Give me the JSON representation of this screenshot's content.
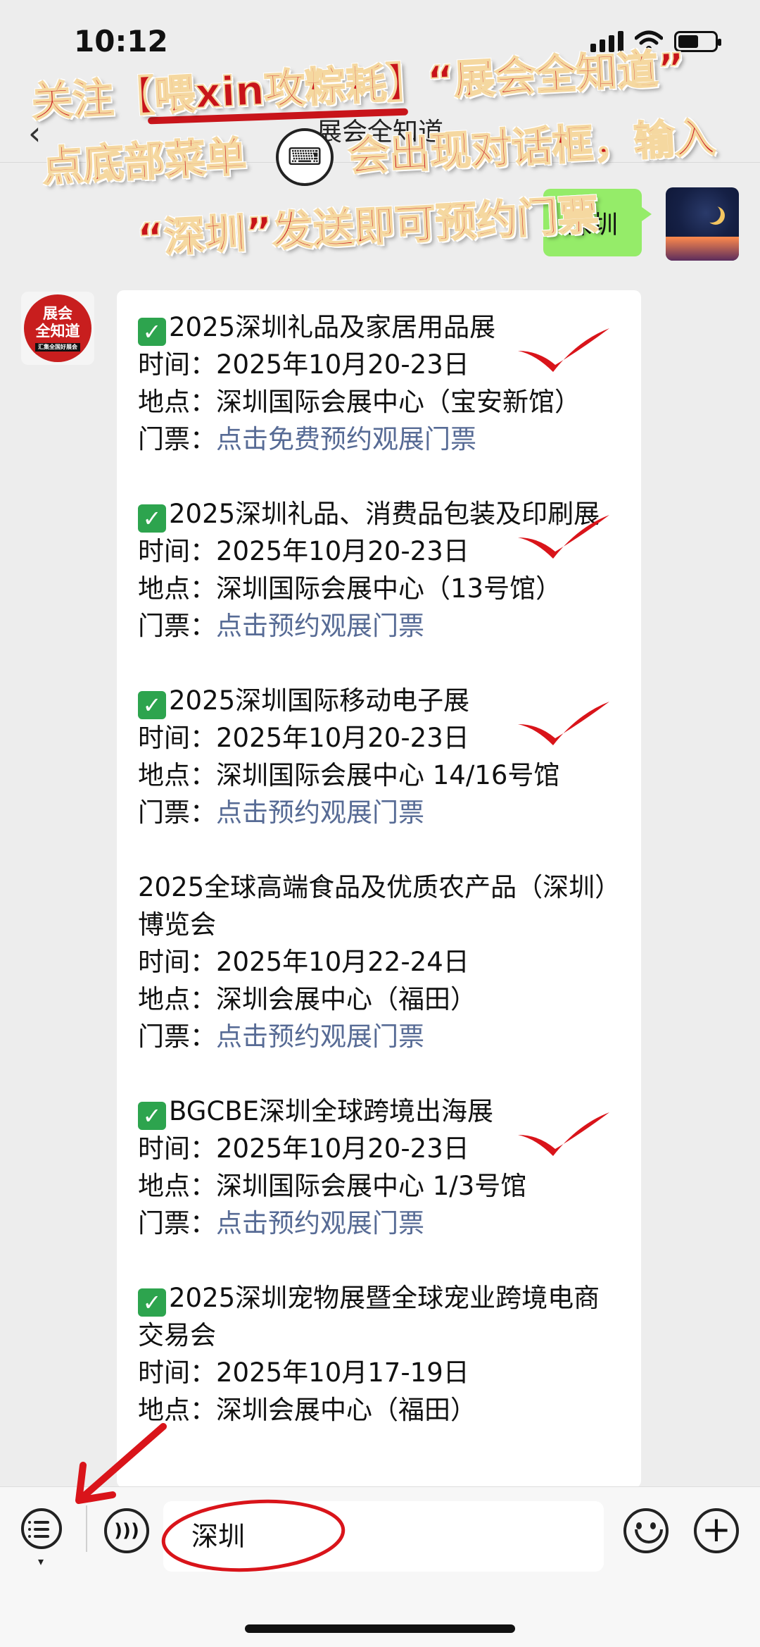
{
  "status_bar": {
    "time": "10:12"
  },
  "nav": {
    "back_glyph": "‹",
    "title": "展会全知道"
  },
  "overlay": {
    "line1": "关注【喂xin攻粽耗】“展会全知道”",
    "line2_left": "点底部菜单",
    "line2_right": "会出现对话框，输入",
    "line3": "“深圳”发送即可预约门票",
    "keyboard_icon": "keyboard-icon"
  },
  "chat": {
    "sent_message": "深圳",
    "bot_avatar": {
      "line1": "展会",
      "line2": "全知道",
      "tagline": "汇集全国好展会"
    },
    "expos": [
      {
        "checked": true,
        "title": "2025深圳礼品及家居用品展",
        "time": "时间：2025年10月20-23日",
        "place": "地点：深圳国际会展中心（宝安新馆）",
        "ticket_label": "门票：",
        "ticket_link": "点击免费预约观展门票",
        "marked": true
      },
      {
        "checked": true,
        "title": "2025深圳礼品、消费品包装及印刷展",
        "time": "时间：2025年10月20-23日",
        "place": "地点：深圳国际会展中心（13号馆）",
        "ticket_label": "门票：",
        "ticket_link": "点击预约观展门票",
        "marked": true
      },
      {
        "checked": true,
        "title": "2025深圳国际移动电子展",
        "time": "时间：2025年10月20-23日",
        "place": "地点：深圳国际会展中心 14/16号馆",
        "ticket_label": "门票：",
        "ticket_link": "点击预约观展门票",
        "marked": true
      },
      {
        "checked": false,
        "title": "2025全球高端食品及优质农产品（深圳）博览会",
        "time": "时间：2025年10月22-24日",
        "place": "地点：深圳会展中心（福田）",
        "ticket_label": "门票：",
        "ticket_link": "点击预约观展门票",
        "marked": false
      },
      {
        "checked": true,
        "title": "BGCBE深圳全球跨境出海展",
        "time": "时间：2025年10月20-23日",
        "place": "地点：深圳国际会展中心 1/3号馆",
        "ticket_label": "门票：",
        "ticket_link": "点击预约观展门票",
        "marked": true
      },
      {
        "checked": true,
        "title": "2025深圳宠物展暨全球宠业跨境电商交易会",
        "time": "时间：2025年10月17-19日",
        "place": "地点：深圳会展中心（福田）",
        "ticket_label": "",
        "ticket_link": "",
        "marked": false
      }
    ]
  },
  "input_bar": {
    "value": "深圳",
    "plus_glyph": "+",
    "check_glyph": "✓"
  },
  "colors": {
    "bubble_sent": "#95ec69",
    "link": "#576b95",
    "annotation_red": "#d9141a",
    "check_green": "#2da44e"
  }
}
